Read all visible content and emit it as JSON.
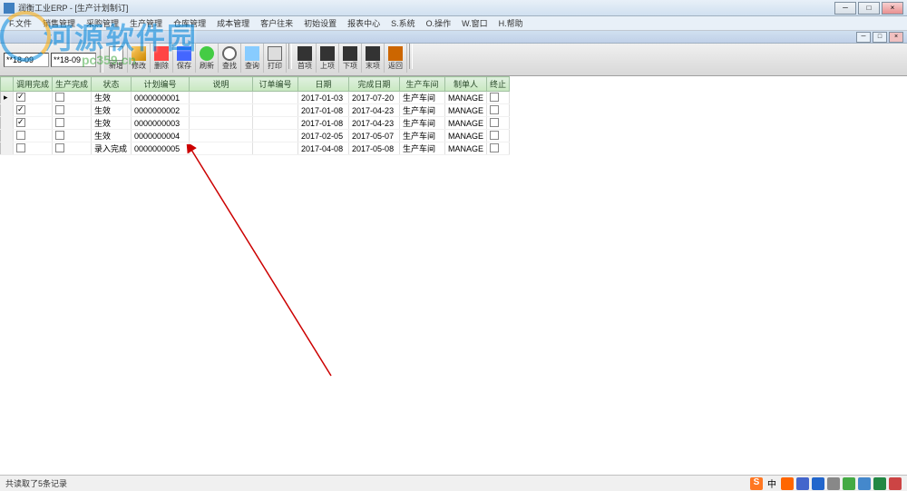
{
  "window": {
    "title": "润衡工业ERP - [生产计划制订]",
    "controls": [
      "─",
      "□",
      "×"
    ]
  },
  "menu": [
    "F.文件",
    "销售管理",
    "采购管理",
    "生产管理",
    "仓库管理",
    "成本管理",
    "客户往来",
    "初始设置",
    "报表中心",
    "S.系统",
    "O.操作",
    "W.窗口",
    "H.帮助"
  ],
  "subwin_controls": [
    "─",
    "□",
    "×"
  ],
  "toolbar": {
    "date_from": "**18-09",
    "date_to": "**18-09",
    "buttons": [
      {
        "icon": "new",
        "label": "新增"
      },
      {
        "icon": "edit",
        "label": "修改"
      },
      {
        "icon": "del",
        "label": "删除"
      },
      {
        "icon": "save",
        "label": "保存"
      },
      {
        "icon": "ref",
        "label": "刷新"
      },
      {
        "icon": "find",
        "label": "查找"
      },
      {
        "icon": "qry",
        "label": "查询"
      },
      {
        "icon": "prt",
        "label": "打印"
      },
      {
        "icon": "first",
        "label": "首项"
      },
      {
        "icon": "prev",
        "label": "上项"
      },
      {
        "icon": "next",
        "label": "下项"
      },
      {
        "icon": "last",
        "label": "末项"
      },
      {
        "icon": "back",
        "label": "返回"
      }
    ]
  },
  "grid": {
    "columns": [
      "",
      "调用完成",
      "生产完成",
      "状态",
      "计划编号",
      "说明",
      "订单编号",
      "日期",
      "完成日期",
      "生产车间",
      "制单人",
      "终止"
    ],
    "rows": [
      {
        "ind": "▸",
        "c1": true,
        "c2": false,
        "status": "生效",
        "plan": "0000000001",
        "desc": "",
        "order": "",
        "date": "2017-01-03",
        "done": "2017-07-20",
        "shop": "生产车间",
        "by": "MANAGE",
        "stop": false
      },
      {
        "ind": "",
        "c1": true,
        "c2": false,
        "status": "生效",
        "plan": "0000000002",
        "desc": "",
        "order": "",
        "date": "2017-01-08",
        "done": "2017-04-23",
        "shop": "生产车间",
        "by": "MANAGE",
        "stop": false
      },
      {
        "ind": "",
        "c1": true,
        "c2": false,
        "status": "生效",
        "plan": "0000000003",
        "desc": "",
        "order": "",
        "date": "2017-01-08",
        "done": "2017-04-23",
        "shop": "生产车间",
        "by": "MANAGE",
        "stop": false
      },
      {
        "ind": "",
        "c1": false,
        "c2": false,
        "status": "生效",
        "plan": "0000000004",
        "desc": "",
        "order": "",
        "date": "2017-02-05",
        "done": "2017-05-07",
        "shop": "生产车间",
        "by": "MANAGE",
        "stop": false
      },
      {
        "ind": "",
        "c1": false,
        "c2": false,
        "status": "录入完成",
        "plan": "0000000005",
        "desc": "",
        "order": "",
        "date": "2017-04-08",
        "done": "2017-05-08",
        "shop": "生产车间",
        "by": "MANAGE",
        "stop": false
      }
    ]
  },
  "watermark": {
    "main": "河源软件园",
    "sub": "pc359.cn"
  },
  "status": "共读取了5条记录",
  "tray_colors": [
    "#ff6600",
    "#4466cc",
    "#2266cc",
    "#888",
    "#44aa44",
    "#4488cc",
    "#228844",
    "#cc4444"
  ],
  "tray_text": "中"
}
